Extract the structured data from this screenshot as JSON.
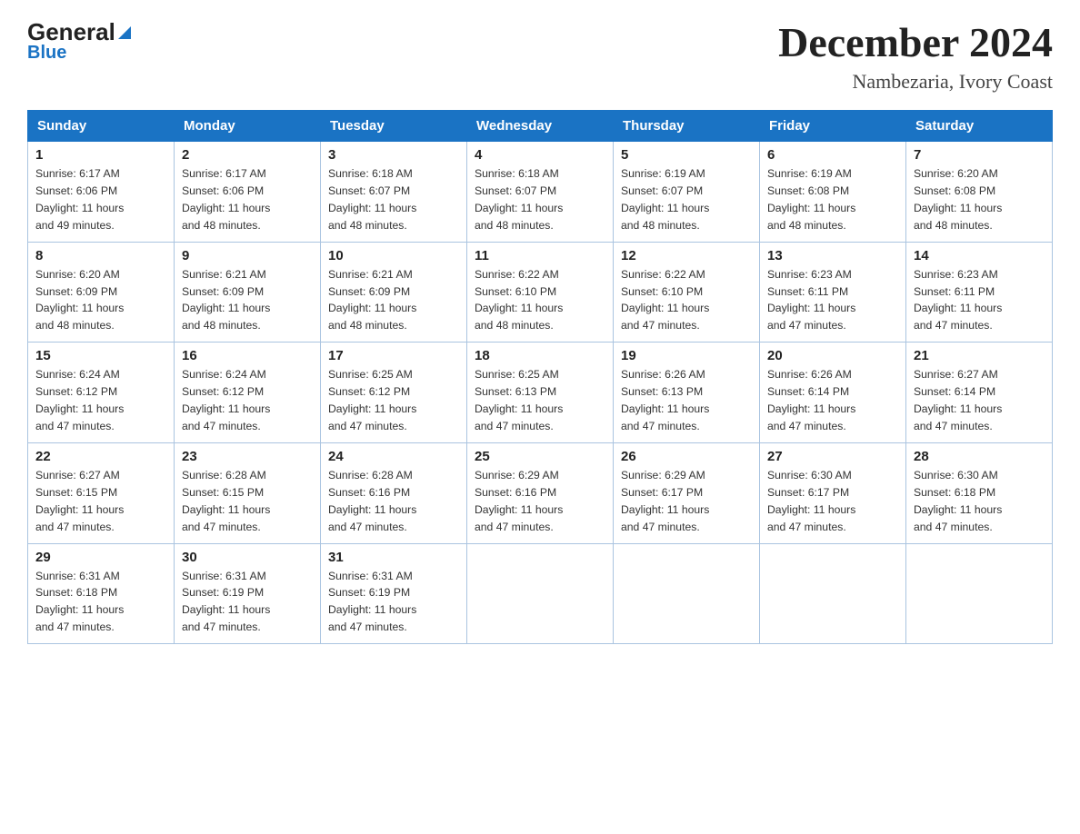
{
  "header": {
    "logo_general": "General",
    "logo_blue": "Blue",
    "title": "December 2024",
    "subtitle": "Nambezaria, Ivory Coast"
  },
  "days_of_week": [
    "Sunday",
    "Monday",
    "Tuesday",
    "Wednesday",
    "Thursday",
    "Friday",
    "Saturday"
  ],
  "weeks": [
    [
      {
        "day": "1",
        "sunrise": "6:17 AM",
        "sunset": "6:06 PM",
        "daylight": "11 hours and 49 minutes."
      },
      {
        "day": "2",
        "sunrise": "6:17 AM",
        "sunset": "6:06 PM",
        "daylight": "11 hours and 48 minutes."
      },
      {
        "day": "3",
        "sunrise": "6:18 AM",
        "sunset": "6:07 PM",
        "daylight": "11 hours and 48 minutes."
      },
      {
        "day": "4",
        "sunrise": "6:18 AM",
        "sunset": "6:07 PM",
        "daylight": "11 hours and 48 minutes."
      },
      {
        "day": "5",
        "sunrise": "6:19 AM",
        "sunset": "6:07 PM",
        "daylight": "11 hours and 48 minutes."
      },
      {
        "day": "6",
        "sunrise": "6:19 AM",
        "sunset": "6:08 PM",
        "daylight": "11 hours and 48 minutes."
      },
      {
        "day": "7",
        "sunrise": "6:20 AM",
        "sunset": "6:08 PM",
        "daylight": "11 hours and 48 minutes."
      }
    ],
    [
      {
        "day": "8",
        "sunrise": "6:20 AM",
        "sunset": "6:09 PM",
        "daylight": "11 hours and 48 minutes."
      },
      {
        "day": "9",
        "sunrise": "6:21 AM",
        "sunset": "6:09 PM",
        "daylight": "11 hours and 48 minutes."
      },
      {
        "day": "10",
        "sunrise": "6:21 AM",
        "sunset": "6:09 PM",
        "daylight": "11 hours and 48 minutes."
      },
      {
        "day": "11",
        "sunrise": "6:22 AM",
        "sunset": "6:10 PM",
        "daylight": "11 hours and 48 minutes."
      },
      {
        "day": "12",
        "sunrise": "6:22 AM",
        "sunset": "6:10 PM",
        "daylight": "11 hours and 47 minutes."
      },
      {
        "day": "13",
        "sunrise": "6:23 AM",
        "sunset": "6:11 PM",
        "daylight": "11 hours and 47 minutes."
      },
      {
        "day": "14",
        "sunrise": "6:23 AM",
        "sunset": "6:11 PM",
        "daylight": "11 hours and 47 minutes."
      }
    ],
    [
      {
        "day": "15",
        "sunrise": "6:24 AM",
        "sunset": "6:12 PM",
        "daylight": "11 hours and 47 minutes."
      },
      {
        "day": "16",
        "sunrise": "6:24 AM",
        "sunset": "6:12 PM",
        "daylight": "11 hours and 47 minutes."
      },
      {
        "day": "17",
        "sunrise": "6:25 AM",
        "sunset": "6:12 PM",
        "daylight": "11 hours and 47 minutes."
      },
      {
        "day": "18",
        "sunrise": "6:25 AM",
        "sunset": "6:13 PM",
        "daylight": "11 hours and 47 minutes."
      },
      {
        "day": "19",
        "sunrise": "6:26 AM",
        "sunset": "6:13 PM",
        "daylight": "11 hours and 47 minutes."
      },
      {
        "day": "20",
        "sunrise": "6:26 AM",
        "sunset": "6:14 PM",
        "daylight": "11 hours and 47 minutes."
      },
      {
        "day": "21",
        "sunrise": "6:27 AM",
        "sunset": "6:14 PM",
        "daylight": "11 hours and 47 minutes."
      }
    ],
    [
      {
        "day": "22",
        "sunrise": "6:27 AM",
        "sunset": "6:15 PM",
        "daylight": "11 hours and 47 minutes."
      },
      {
        "day": "23",
        "sunrise": "6:28 AM",
        "sunset": "6:15 PM",
        "daylight": "11 hours and 47 minutes."
      },
      {
        "day": "24",
        "sunrise": "6:28 AM",
        "sunset": "6:16 PM",
        "daylight": "11 hours and 47 minutes."
      },
      {
        "day": "25",
        "sunrise": "6:29 AM",
        "sunset": "6:16 PM",
        "daylight": "11 hours and 47 minutes."
      },
      {
        "day": "26",
        "sunrise": "6:29 AM",
        "sunset": "6:17 PM",
        "daylight": "11 hours and 47 minutes."
      },
      {
        "day": "27",
        "sunrise": "6:30 AM",
        "sunset": "6:17 PM",
        "daylight": "11 hours and 47 minutes."
      },
      {
        "day": "28",
        "sunrise": "6:30 AM",
        "sunset": "6:18 PM",
        "daylight": "11 hours and 47 minutes."
      }
    ],
    [
      {
        "day": "29",
        "sunrise": "6:31 AM",
        "sunset": "6:18 PM",
        "daylight": "11 hours and 47 minutes."
      },
      {
        "day": "30",
        "sunrise": "6:31 AM",
        "sunset": "6:19 PM",
        "daylight": "11 hours and 47 minutes."
      },
      {
        "day": "31",
        "sunrise": "6:31 AM",
        "sunset": "6:19 PM",
        "daylight": "11 hours and 47 minutes."
      },
      null,
      null,
      null,
      null
    ]
  ],
  "labels": {
    "sunrise": "Sunrise:",
    "sunset": "Sunset:",
    "daylight": "Daylight:"
  }
}
